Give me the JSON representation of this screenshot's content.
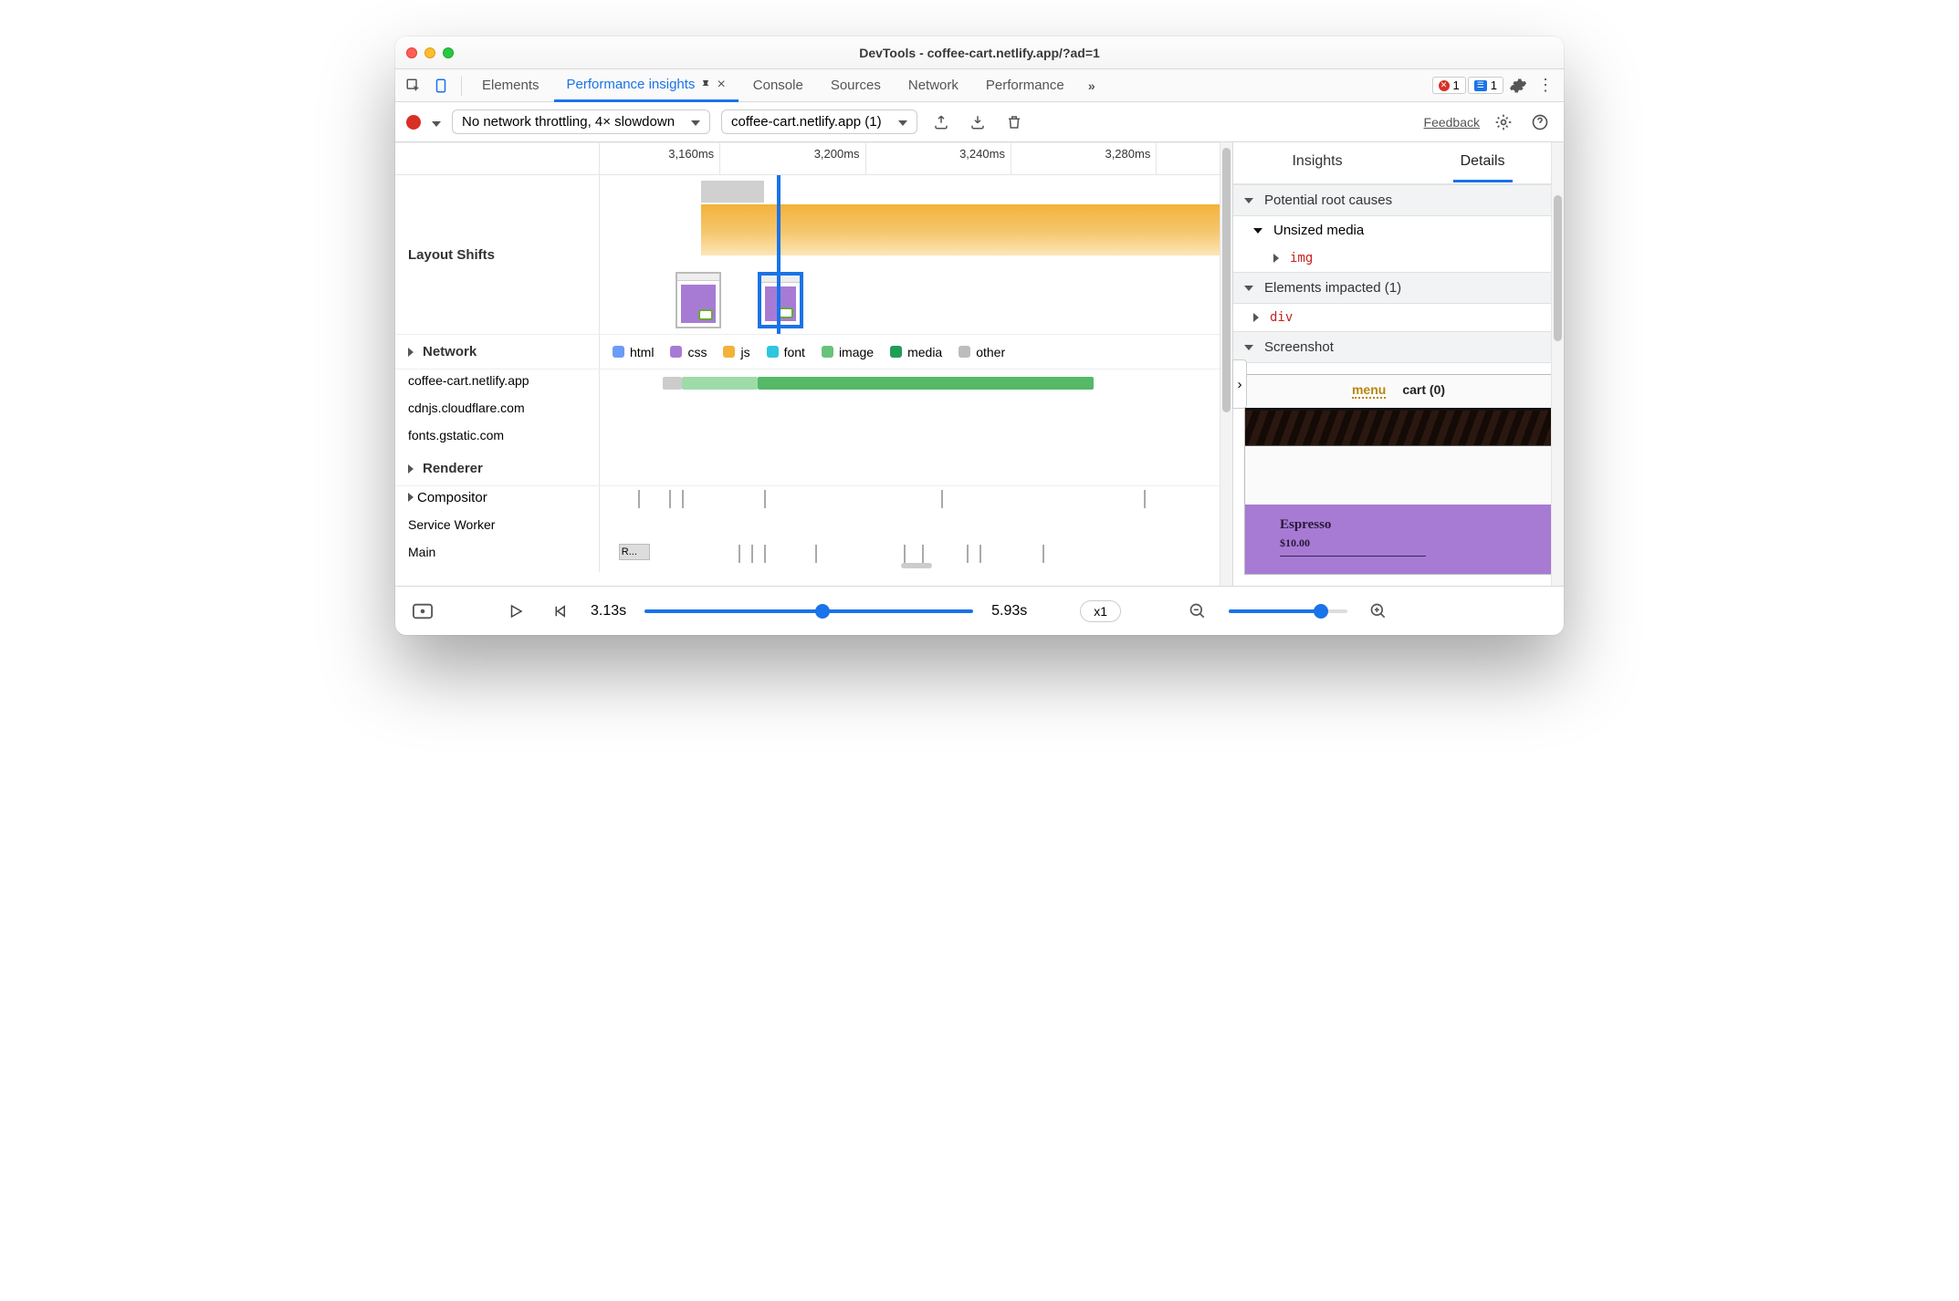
{
  "window_title": "DevTools - coffee-cart.netlify.app/?ad=1",
  "tabs": {
    "elements": "Elements",
    "perf_insights": "Performance insights",
    "console": "Console",
    "sources": "Sources",
    "network": "Network",
    "performance": "Performance"
  },
  "tab_badges": {
    "errors": "1",
    "issues": "1"
  },
  "toolbar": {
    "throttle": "No network throttling, 4× slowdown",
    "target": "coffee-cart.netlify.app (1)",
    "feedback": "Feedback"
  },
  "ruler": [
    "3,160ms",
    "3,200ms",
    "3,240ms",
    "3,280ms"
  ],
  "timeline": {
    "layout_shifts_label": "Layout Shifts",
    "network_label": "Network",
    "renderer_label": "Renderer",
    "compositor_label": "Compositor",
    "service_worker_label": "Service Worker",
    "main_label": "Main",
    "main_block": "R...",
    "legend": {
      "html": "html",
      "css": "css",
      "js": "js",
      "font": "font",
      "image": "image",
      "media": "media",
      "other": "other"
    },
    "net_hosts": [
      "coffee-cart.netlify.app",
      "cdnjs.cloudflare.com",
      "fonts.gstatic.com"
    ]
  },
  "details": {
    "tab_insights": "Insights",
    "tab_details": "Details",
    "root_causes": "Potential root causes",
    "unsized_media": "Unsized media",
    "img_el": "img",
    "impacted": "Elements impacted (1)",
    "div_el": "div",
    "screenshot": "Screenshot",
    "preview": {
      "menu": "menu",
      "cart": "cart (0)",
      "item_name": "Espresso",
      "item_price": "$10.00"
    }
  },
  "footer": {
    "start_time": "3.13s",
    "end_time": "5.93s",
    "zoom": "x1"
  },
  "colors": {
    "html": "#6a9cf8",
    "css": "#a77bd4",
    "js": "#f3b23a",
    "font": "#2fc5e0",
    "image": "#69c27b",
    "media": "#1f9d55",
    "other": "#bdbdbd",
    "accent": "#1a73e8"
  }
}
